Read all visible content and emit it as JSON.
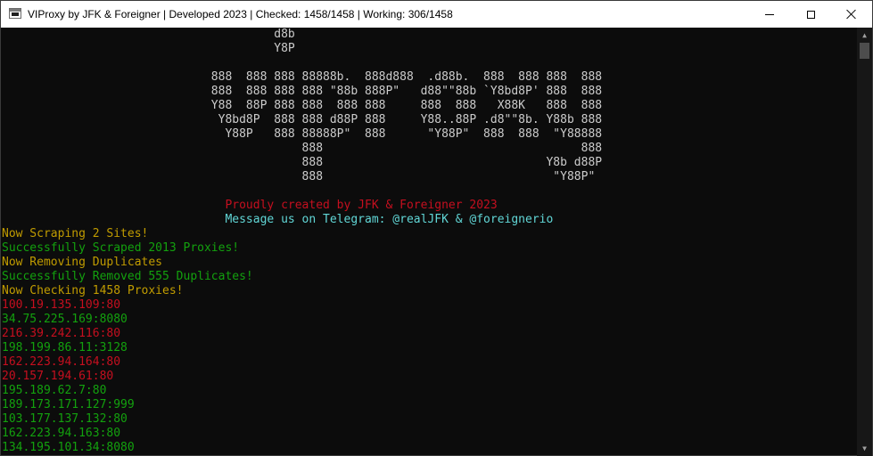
{
  "window": {
    "title": "VIProxy by JFK & Foreigner | Developed 2023 | Checked: 1458/1458 | Working: 306/1458",
    "app_icon": "console-icon",
    "controls": {
      "minimize": "minimize-icon",
      "maximize": "maximize-icon",
      "close": "close-icon"
    }
  },
  "colors": {
    "background": "#0c0c0c",
    "banner": "#cccccc",
    "red": "#c50f1f",
    "green": "#13a10e",
    "yellow": "#c19c00",
    "cyan": "#61d6d6"
  },
  "banner_lines": [
    "                                       d8b",
    "                                       Y8P",
    "",
    "                              888  888 888 88888b.  888d888  .d88b.  888  888 888  888",
    "                              888  888 888 888 \"88b 888P\"   d88\"\"88b `Y8bd8P' 888  888",
    "                              Y88  88P 888 888  888 888     888  888   X88K   888  888",
    "                               Y8bd8P  888 888 d88P 888     Y88..88P .d8\"\"8b. Y88b 888",
    "                                Y88P   888 88888P\"  888      \"Y88P\"  888  888  \"Y88888",
    "                                           888                                     888",
    "                                           888                                Y8b d88P",
    "                                           888                                 \"Y88P\"",
    ""
  ],
  "credits": {
    "created_by": "                                Proudly created by JFK & Foreigner 2023",
    "telegram": "                                Message us on Telegram: @realJFK & @foreignerio"
  },
  "status_lines": [
    {
      "text": "Now Scraping 2 Sites!",
      "color": "yellow"
    },
    {
      "text": "Successfully Scraped 2013 Proxies!",
      "color": "green"
    },
    {
      "text": "Now Removing Duplicates",
      "color": "yellow"
    },
    {
      "text": "Successfully Removed 555 Duplicates!",
      "color": "green"
    },
    {
      "text": "Now Checking 1458 Proxies!",
      "color": "yellow"
    }
  ],
  "proxy_results": [
    {
      "text": "100.19.135.109:80",
      "color": "red"
    },
    {
      "text": "34.75.225.169:8080",
      "color": "green"
    },
    {
      "text": "216.39.242.116:80",
      "color": "red"
    },
    {
      "text": "198.199.86.11:3128",
      "color": "green"
    },
    {
      "text": "162.223.94.164:80",
      "color": "red"
    },
    {
      "text": "20.157.194.61:80",
      "color": "red"
    },
    {
      "text": "195.189.62.7:80",
      "color": "green"
    },
    {
      "text": "189.173.171.127:999",
      "color": "green"
    },
    {
      "text": "103.177.137.132:80",
      "color": "green"
    },
    {
      "text": "162.223.94.163:80",
      "color": "green"
    },
    {
      "text": "134.195.101.34:8080",
      "color": "green"
    }
  ]
}
